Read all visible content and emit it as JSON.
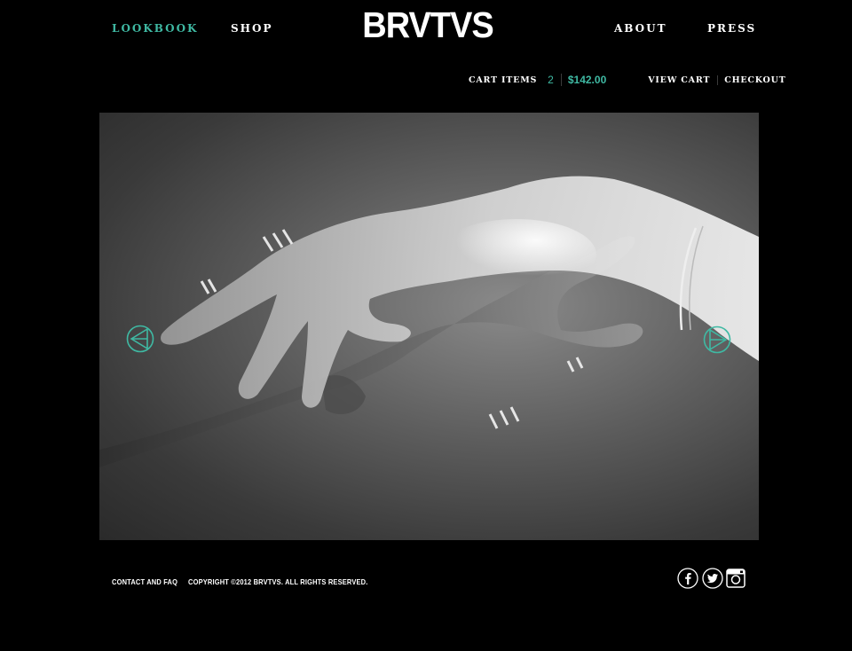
{
  "nav": {
    "lookbook": "LOOKBOOK",
    "shop": "SHOP",
    "logo": "BRVTVS",
    "about": "ABOUT",
    "press": "PRESS"
  },
  "cart": {
    "label": "CART ITEMS",
    "count": "2",
    "total": "$142.00",
    "view_cart": "VIEW CART",
    "checkout": "CHECKOUT"
  },
  "hero": {
    "prev_icon": "triangle-left-circle-icon",
    "next_icon": "triangle-right-circle-icon"
  },
  "footer": {
    "contact": "CONTACT AND FAQ",
    "copyright": "COPYRIGHT ©2012 BRVTVS. ALL RIGHTS RESERVED.",
    "social_icons": [
      "facebook-icon",
      "twitter-icon",
      "instagram-icon"
    ]
  },
  "colors": {
    "accent": "#3fb9a3",
    "background": "#000000"
  }
}
